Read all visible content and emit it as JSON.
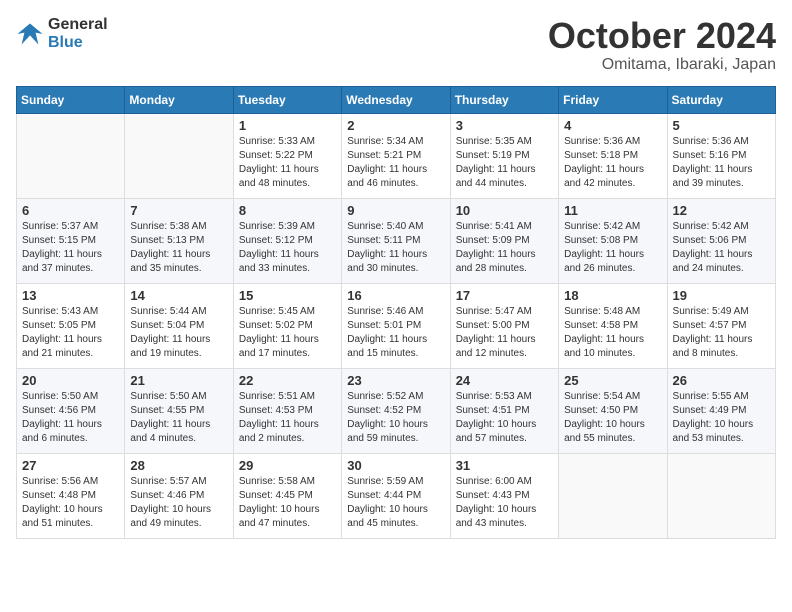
{
  "header": {
    "logo_line1": "General",
    "logo_line2": "Blue",
    "month": "October 2024",
    "location": "Omitama, Ibaraki, Japan"
  },
  "weekdays": [
    "Sunday",
    "Monday",
    "Tuesday",
    "Wednesday",
    "Thursday",
    "Friday",
    "Saturday"
  ],
  "weeks": [
    [
      {
        "day": "",
        "sunrise": "",
        "sunset": "",
        "daylight": ""
      },
      {
        "day": "",
        "sunrise": "",
        "sunset": "",
        "daylight": ""
      },
      {
        "day": "1",
        "sunrise": "Sunrise: 5:33 AM",
        "sunset": "Sunset: 5:22 PM",
        "daylight": "Daylight: 11 hours and 48 minutes."
      },
      {
        "day": "2",
        "sunrise": "Sunrise: 5:34 AM",
        "sunset": "Sunset: 5:21 PM",
        "daylight": "Daylight: 11 hours and 46 minutes."
      },
      {
        "day": "3",
        "sunrise": "Sunrise: 5:35 AM",
        "sunset": "Sunset: 5:19 PM",
        "daylight": "Daylight: 11 hours and 44 minutes."
      },
      {
        "day": "4",
        "sunrise": "Sunrise: 5:36 AM",
        "sunset": "Sunset: 5:18 PM",
        "daylight": "Daylight: 11 hours and 42 minutes."
      },
      {
        "day": "5",
        "sunrise": "Sunrise: 5:36 AM",
        "sunset": "Sunset: 5:16 PM",
        "daylight": "Daylight: 11 hours and 39 minutes."
      }
    ],
    [
      {
        "day": "6",
        "sunrise": "Sunrise: 5:37 AM",
        "sunset": "Sunset: 5:15 PM",
        "daylight": "Daylight: 11 hours and 37 minutes."
      },
      {
        "day": "7",
        "sunrise": "Sunrise: 5:38 AM",
        "sunset": "Sunset: 5:13 PM",
        "daylight": "Daylight: 11 hours and 35 minutes."
      },
      {
        "day": "8",
        "sunrise": "Sunrise: 5:39 AM",
        "sunset": "Sunset: 5:12 PM",
        "daylight": "Daylight: 11 hours and 33 minutes."
      },
      {
        "day": "9",
        "sunrise": "Sunrise: 5:40 AM",
        "sunset": "Sunset: 5:11 PM",
        "daylight": "Daylight: 11 hours and 30 minutes."
      },
      {
        "day": "10",
        "sunrise": "Sunrise: 5:41 AM",
        "sunset": "Sunset: 5:09 PM",
        "daylight": "Daylight: 11 hours and 28 minutes."
      },
      {
        "day": "11",
        "sunrise": "Sunrise: 5:42 AM",
        "sunset": "Sunset: 5:08 PM",
        "daylight": "Daylight: 11 hours and 26 minutes."
      },
      {
        "day": "12",
        "sunrise": "Sunrise: 5:42 AM",
        "sunset": "Sunset: 5:06 PM",
        "daylight": "Daylight: 11 hours and 24 minutes."
      }
    ],
    [
      {
        "day": "13",
        "sunrise": "Sunrise: 5:43 AM",
        "sunset": "Sunset: 5:05 PM",
        "daylight": "Daylight: 11 hours and 21 minutes."
      },
      {
        "day": "14",
        "sunrise": "Sunrise: 5:44 AM",
        "sunset": "Sunset: 5:04 PM",
        "daylight": "Daylight: 11 hours and 19 minutes."
      },
      {
        "day": "15",
        "sunrise": "Sunrise: 5:45 AM",
        "sunset": "Sunset: 5:02 PM",
        "daylight": "Daylight: 11 hours and 17 minutes."
      },
      {
        "day": "16",
        "sunrise": "Sunrise: 5:46 AM",
        "sunset": "Sunset: 5:01 PM",
        "daylight": "Daylight: 11 hours and 15 minutes."
      },
      {
        "day": "17",
        "sunrise": "Sunrise: 5:47 AM",
        "sunset": "Sunset: 5:00 PM",
        "daylight": "Daylight: 11 hours and 12 minutes."
      },
      {
        "day": "18",
        "sunrise": "Sunrise: 5:48 AM",
        "sunset": "Sunset: 4:58 PM",
        "daylight": "Daylight: 11 hours and 10 minutes."
      },
      {
        "day": "19",
        "sunrise": "Sunrise: 5:49 AM",
        "sunset": "Sunset: 4:57 PM",
        "daylight": "Daylight: 11 hours and 8 minutes."
      }
    ],
    [
      {
        "day": "20",
        "sunrise": "Sunrise: 5:50 AM",
        "sunset": "Sunset: 4:56 PM",
        "daylight": "Daylight: 11 hours and 6 minutes."
      },
      {
        "day": "21",
        "sunrise": "Sunrise: 5:50 AM",
        "sunset": "Sunset: 4:55 PM",
        "daylight": "Daylight: 11 hours and 4 minutes."
      },
      {
        "day": "22",
        "sunrise": "Sunrise: 5:51 AM",
        "sunset": "Sunset: 4:53 PM",
        "daylight": "Daylight: 11 hours and 2 minutes."
      },
      {
        "day": "23",
        "sunrise": "Sunrise: 5:52 AM",
        "sunset": "Sunset: 4:52 PM",
        "daylight": "Daylight: 10 hours and 59 minutes."
      },
      {
        "day": "24",
        "sunrise": "Sunrise: 5:53 AM",
        "sunset": "Sunset: 4:51 PM",
        "daylight": "Daylight: 10 hours and 57 minutes."
      },
      {
        "day": "25",
        "sunrise": "Sunrise: 5:54 AM",
        "sunset": "Sunset: 4:50 PM",
        "daylight": "Daylight: 10 hours and 55 minutes."
      },
      {
        "day": "26",
        "sunrise": "Sunrise: 5:55 AM",
        "sunset": "Sunset: 4:49 PM",
        "daylight": "Daylight: 10 hours and 53 minutes."
      }
    ],
    [
      {
        "day": "27",
        "sunrise": "Sunrise: 5:56 AM",
        "sunset": "Sunset: 4:48 PM",
        "daylight": "Daylight: 10 hours and 51 minutes."
      },
      {
        "day": "28",
        "sunrise": "Sunrise: 5:57 AM",
        "sunset": "Sunset: 4:46 PM",
        "daylight": "Daylight: 10 hours and 49 minutes."
      },
      {
        "day": "29",
        "sunrise": "Sunrise: 5:58 AM",
        "sunset": "Sunset: 4:45 PM",
        "daylight": "Daylight: 10 hours and 47 minutes."
      },
      {
        "day": "30",
        "sunrise": "Sunrise: 5:59 AM",
        "sunset": "Sunset: 4:44 PM",
        "daylight": "Daylight: 10 hours and 45 minutes."
      },
      {
        "day": "31",
        "sunrise": "Sunrise: 6:00 AM",
        "sunset": "Sunset: 4:43 PM",
        "daylight": "Daylight: 10 hours and 43 minutes."
      },
      {
        "day": "",
        "sunrise": "",
        "sunset": "",
        "daylight": ""
      },
      {
        "day": "",
        "sunrise": "",
        "sunset": "",
        "daylight": ""
      }
    ]
  ]
}
